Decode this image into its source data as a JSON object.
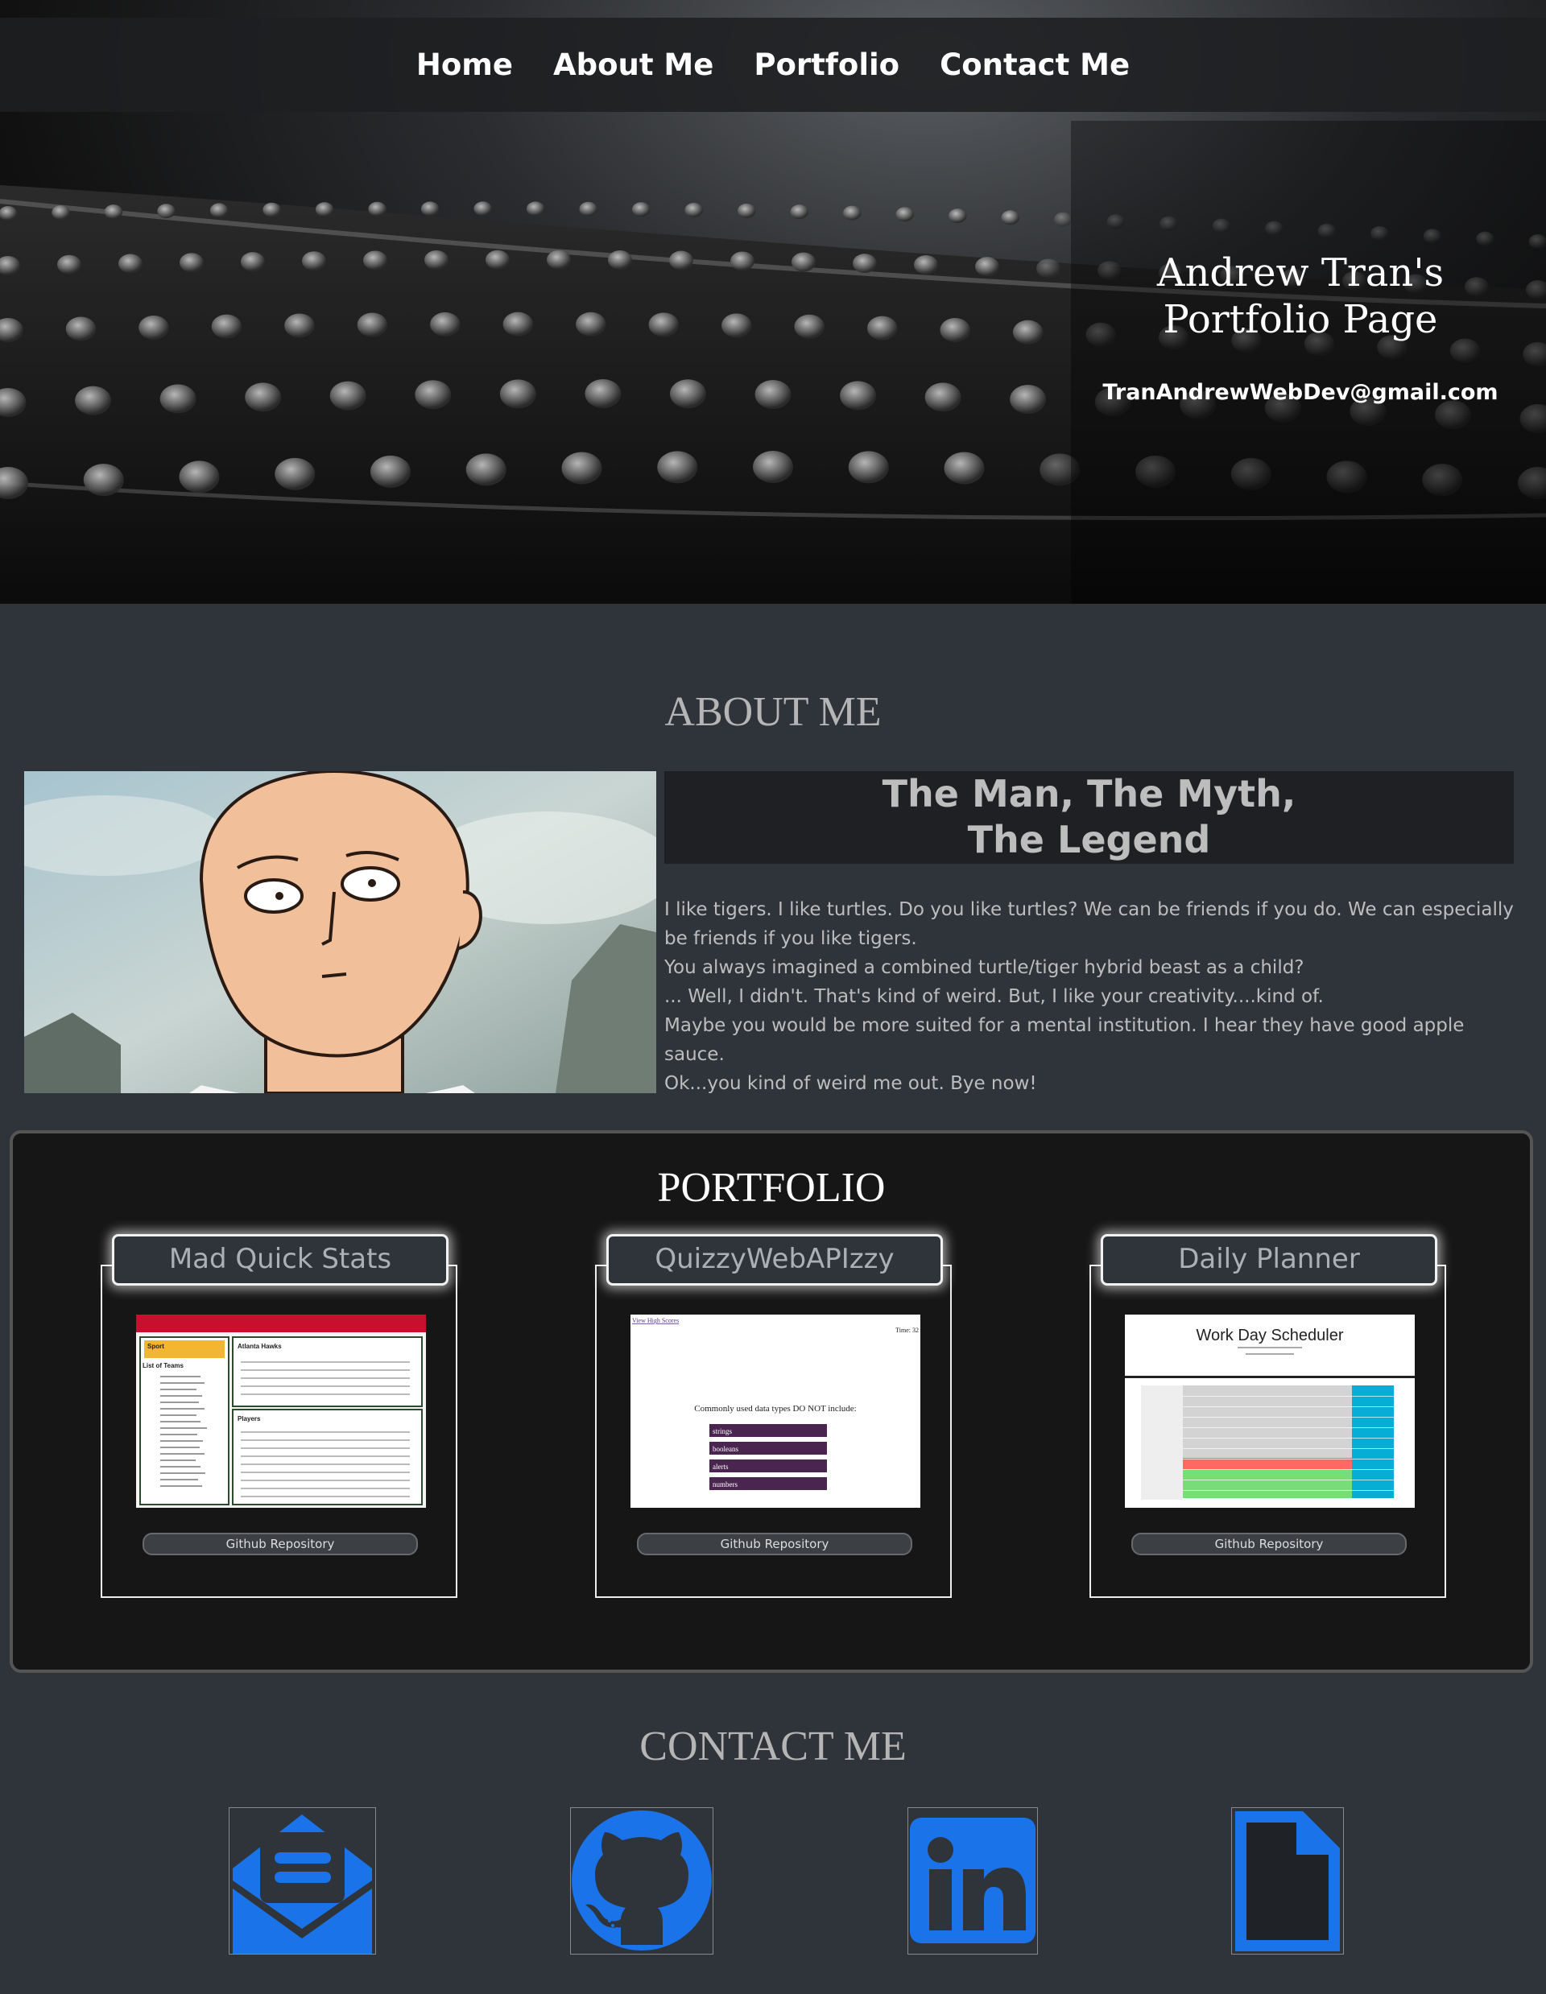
{
  "nav": {
    "items": [
      {
        "label": "Home"
      },
      {
        "label": "About Me"
      },
      {
        "label": "Portfolio"
      },
      {
        "label": "Contact Me"
      }
    ]
  },
  "hero": {
    "title_line1": "Andrew Tran's",
    "title_line2": "Portfolio Page",
    "email": "TranAndrewWebDev@gmail.com"
  },
  "about": {
    "title": "ABOUT ME",
    "heading_line1": "The Man, The Myth,",
    "heading_line2": "The Legend",
    "paragraphs": [
      "I like tigers. I like turtles. Do you like turtles? We can be friends if you do. We can especially be friends if you like tigers.",
      "You always imagined a combined turtle/tiger hybrid beast as a child?",
      "... Well, I didn't. That's kind of weird. But, I like your creativity....kind of.",
      "Maybe you would be more suited for a mental institution. I hear they have good apple sauce.",
      "Ok...you kind of weird me out. Bye now!"
    ]
  },
  "portfolio": {
    "title": "PORTFOLIO",
    "projects": [
      {
        "name": "Mad Quick Stats",
        "button": "Github Repository",
        "preview": {
          "sidebar_label": "Sport",
          "list_title": "List of Teams",
          "team_title": "Atlanta Hawks",
          "players_title": "Players"
        }
      },
      {
        "name": "QuizzyWebAPIzzy",
        "button": "Github Repository",
        "preview": {
          "link": "View High Scores",
          "time": "Time: 32",
          "question": "Commonly used data types DO NOT include:",
          "answers": [
            "strings",
            "booleans",
            "alerts",
            "numbers"
          ]
        }
      },
      {
        "name": "Daily Planner",
        "button": "Github Repository",
        "preview": {
          "title": "Work Day Scheduler"
        }
      }
    ]
  },
  "contact": {
    "title": "CONTACT ME",
    "icons": [
      "email-icon",
      "github-icon",
      "linkedin-icon",
      "resume-file-icon"
    ],
    "accent": "#1a73e8"
  },
  "colors": {
    "page_bg": "#2f343b",
    "portfolio_bg": "#161617",
    "nav_bg": "#1e1f21",
    "about_heading_bg": "#1f2023"
  }
}
